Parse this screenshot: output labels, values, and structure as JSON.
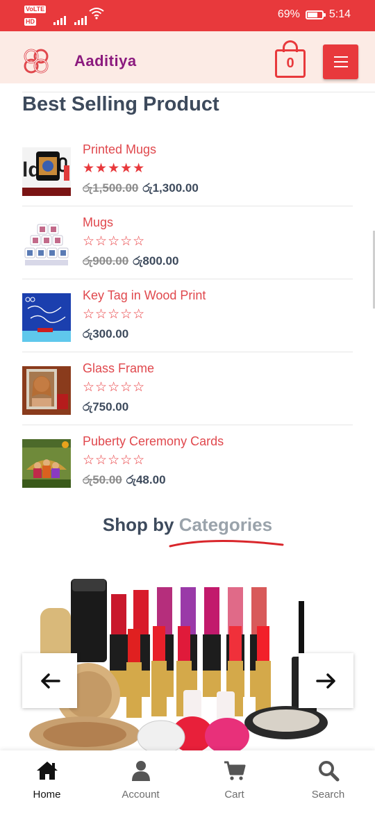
{
  "status_bar": {
    "volte": "VoLTE",
    "hd": "HD",
    "battery": "69%",
    "battery_level": 0.69,
    "time": "5:14"
  },
  "header": {
    "brand": "Aaditiya",
    "cart_count": "0",
    "colors": {
      "accent": "#e8393c",
      "brand": "#8b1a7e",
      "header_bg": "#fcebe5"
    }
  },
  "best_selling": {
    "title": "Best Selling Product",
    "products": [
      {
        "name": "Printed Mugs",
        "rating": 5,
        "stars": "★★★★★",
        "old_price": "රු1,500.00",
        "price": "රු1,300.00"
      },
      {
        "name": "Mugs",
        "rating": 0,
        "stars": "☆☆☆☆☆",
        "old_price": "රු900.00",
        "price": "රු800.00"
      },
      {
        "name": "Key Tag in Wood Print",
        "rating": 0,
        "stars": "☆☆☆☆☆",
        "old_price": "",
        "price": "රු300.00"
      },
      {
        "name": "Glass Frame",
        "rating": 0,
        "stars": "☆☆☆☆☆",
        "old_price": "",
        "price": "රු750.00"
      },
      {
        "name": "Puberty Ceremony Cards",
        "rating": 0,
        "stars": "☆☆☆☆☆",
        "old_price": "රු50.00",
        "price": "රු48.00"
      }
    ]
  },
  "categories": {
    "title_plain": "Shop by ",
    "title_accent": "Categories",
    "prev_icon": "arrow-left-icon",
    "next_icon": "arrow-right-icon"
  },
  "bottom_nav": [
    {
      "label": "Home",
      "icon": "home-icon",
      "active": true
    },
    {
      "label": "Account",
      "icon": "user-icon",
      "active": false
    },
    {
      "label": "Cart",
      "icon": "cart-icon",
      "active": false
    },
    {
      "label": "Search",
      "icon": "search-icon",
      "active": false
    }
  ]
}
